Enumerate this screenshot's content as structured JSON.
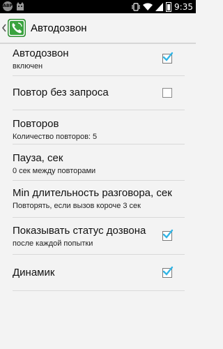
{
  "statusbar": {
    "time": "9:35",
    "notif_icons": [
      "ABP",
      "··"
    ]
  },
  "actionbar": {
    "title": "Автодозвон"
  },
  "settings": [
    {
      "title": "Автодозвон",
      "summary": "включен",
      "checkbox": true,
      "checked": true
    },
    {
      "title": "Повтор без запроса",
      "summary": "",
      "checkbox": true,
      "checked": false
    },
    {
      "title": "Повторов",
      "summary": "Количество повторов: 5",
      "checkbox": false
    },
    {
      "title": "Пауза, сек",
      "summary": "0 сек между повторами",
      "checkbox": false
    },
    {
      "title": "Min длительность разговора, сек",
      "summary": "Повторять, если вызов короче 3 сек",
      "checkbox": false
    },
    {
      "title": "Показывать статус дозвона",
      "summary": "после каждой попытки",
      "checkbox": true,
      "checked": true
    },
    {
      "title": "Динамик",
      "summary": "",
      "checkbox": true,
      "checked": true
    }
  ],
  "colors": {
    "check": "#33b5e5",
    "divider": "#d9d9d9",
    "background": "#f3f3f3"
  }
}
